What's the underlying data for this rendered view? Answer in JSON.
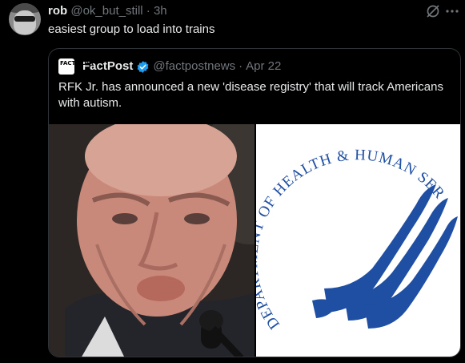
{
  "post": {
    "display_name": "rob",
    "handle": "@ok_but_still",
    "separator": "·",
    "time": "3h",
    "text": "easiest group to load into trains"
  },
  "quoted": {
    "display_name": "FactPost",
    "logo_text": "FACT POST",
    "handle": "@factpostnews",
    "separator": "·",
    "date": "Apr 22",
    "text": "RFK Jr. has announced a new 'disease registry' that will track Americans with autism.",
    "media": [
      {
        "kind": "photo",
        "description_icon": "person-photo"
      },
      {
        "kind": "logo",
        "arc_text": "DEPARTMENT OF HEALTH & HUMAN SERVICES·USA"
      }
    ]
  },
  "icons": {
    "grok": "grok-icon",
    "more": "more-icon",
    "verified": "verified-badge-icon"
  },
  "colors": {
    "background": "#000000",
    "text": "#e7e9ea",
    "muted": "#71767b",
    "verified": "#1d9bf0",
    "hhs_blue": "#1f4fa3"
  }
}
